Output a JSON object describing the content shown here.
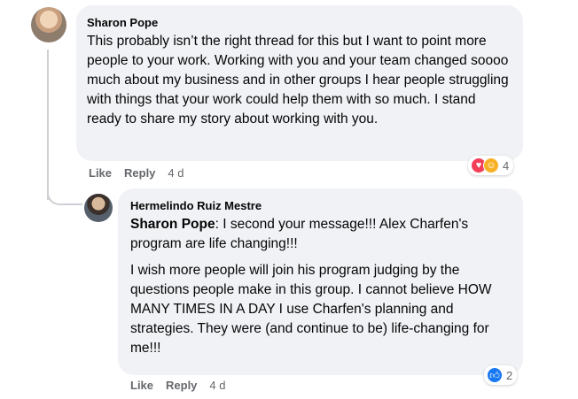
{
  "comment": {
    "author": "Sharon Pope",
    "text": "This probably isn’t the right thread for this but I want to point more people to your work. Working with you and your team changed soooo much about my business and in other groups I hear people struggling with things that your work could help them with so much. I stand ready to share my story about working with you.",
    "actions": {
      "like": "Like",
      "reply": "Reply",
      "time": "4 d"
    },
    "reactions": {
      "icons": [
        "love-icon",
        "care-icon"
      ],
      "count": "4"
    }
  },
  "reply": {
    "author": "Hermelindo Ruiz Mestre",
    "mention": "Sharon Pope",
    "text_1": ": I second your message!!! Alex Charfen's program are life changing!!!",
    "text_2": "I wish more people will join his program judging by the questions people make in this group. I cannot believe HOW MANY TIMES IN A DAY I use Charfen's planning and strategies. They were (and continue to be) life-changing for me!!!",
    "actions": {
      "like": "Like",
      "reply": "Reply",
      "time": "4 d"
    },
    "reactions": {
      "icons": [
        "like-icon"
      ],
      "count": "2"
    }
  },
  "colors": {
    "bubble": "#f0f2f5",
    "secondary_text": "#65676b",
    "like_blue": "#1877f2",
    "love_red": "#f33e58"
  }
}
